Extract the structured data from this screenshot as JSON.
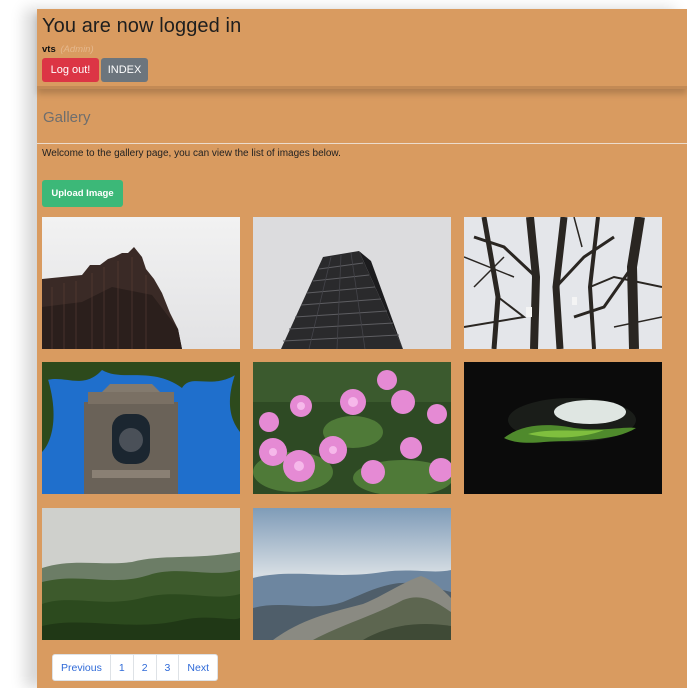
{
  "header": {
    "title": "You are now logged in",
    "username": "vts",
    "role": "(Admin)",
    "logout_label": "Log out!",
    "index_label": "INDEX"
  },
  "gallery": {
    "heading": "Gallery",
    "welcome": "Welcome to the gallery page, you can view the list of images below.",
    "upload_label": "Upload Image",
    "images": [
      {
        "subject": "dark brick tower against pale sky"
      },
      {
        "subject": "glass skyscraper from below"
      },
      {
        "subject": "bare tree branches"
      },
      {
        "subject": "stone bell tower under blue sky"
      },
      {
        "subject": "pink flowers"
      },
      {
        "subject": "cave opening with green moss"
      },
      {
        "subject": "forested hills under overcast sky"
      },
      {
        "subject": "rocky mountain ridge with clouds"
      }
    ]
  },
  "pagination": {
    "prev_label": "Previous",
    "pages": [
      "1",
      "2",
      "3"
    ],
    "next_label": "Next"
  },
  "colors": {
    "page_background": "#d99b60",
    "logout": "#dc3545",
    "index": "#6c757d",
    "upload": "#3cb878",
    "link": "#2f6ad8"
  }
}
